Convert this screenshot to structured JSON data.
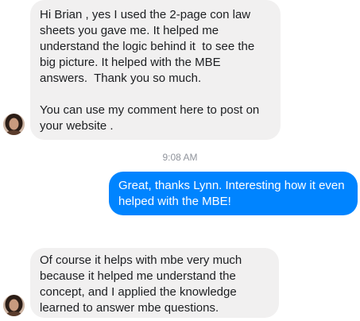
{
  "chat": {
    "messages": [
      {
        "sender": "other",
        "text": "Hi Brian , yes I used the 2-page con law sheets you gave me. It helped me understand the logic behind it  to see the big picture. It helped with the MBE answers.  Thank you so much.\n\nYou can use my comment here to post on your website ."
      },
      {
        "sender": "self",
        "text": "Great, thanks Lynn. Interesting how it even helped with the MBE!"
      },
      {
        "sender": "other",
        "text": "Of course it helps with mbe very much because it helped me understand the concept, and I applied the knowledge learned to answer mbe questions."
      }
    ],
    "timestamp": "9:08 AM"
  },
  "colors": {
    "incoming_bubble": "#f1f0f0",
    "outgoing_bubble": "#0084ff",
    "timestamp_text": "#90949c"
  }
}
